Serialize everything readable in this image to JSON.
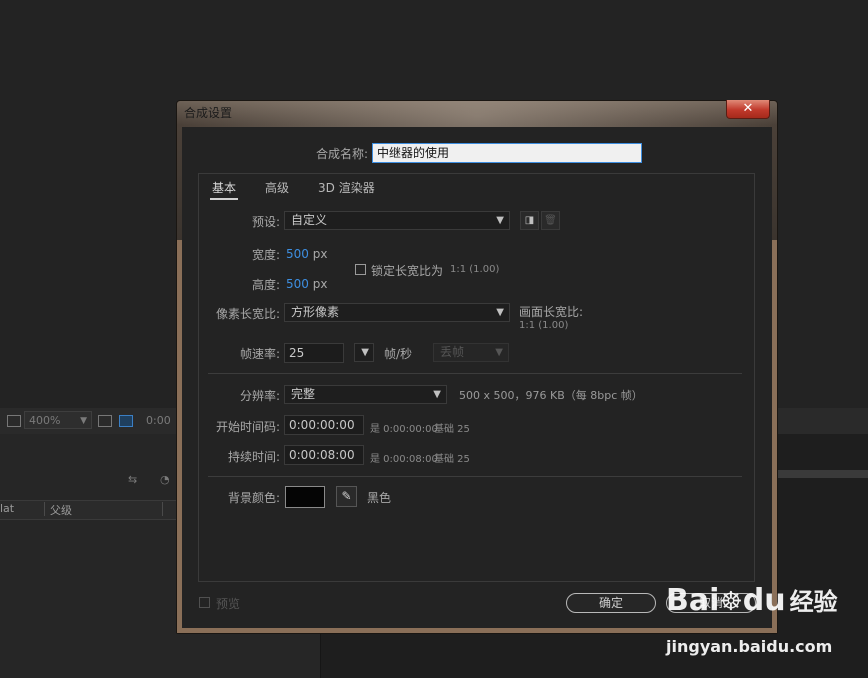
{
  "background": {
    "zoom": "400%",
    "timecode_partial": "0:00",
    "layer_col_1": "lat",
    "layer_col_2": "父级"
  },
  "dialog": {
    "title": "合成设置",
    "close": "✕",
    "name_label": "合成名称:",
    "name_value": "中继器的使用",
    "tabs": [
      "基本",
      "高级",
      "3D 渲染器"
    ],
    "preset_label": "预设:",
    "preset_value": "自定义",
    "width_label": "宽度:",
    "width_value": "500",
    "height_label": "高度:",
    "height_value": "500",
    "unit_px": "px",
    "lock_ratio_label": "锁定长宽比为",
    "lock_ratio_value": "1:1 (1.00)",
    "pixel_aspect_label": "像素长宽比:",
    "pixel_aspect_value": "方形像素",
    "frame_aspect_label": "画面长宽比:",
    "frame_aspect_value": "1:1 (1.00)",
    "frame_rate_label": "帧速率:",
    "frame_rate_value": "25",
    "frame_rate_unit": "帧/秒",
    "drop_frame_value": "丢帧",
    "resolution_label": "分辨率:",
    "resolution_value": "完整",
    "resolution_info": "500 x 500，976 KB（每 8bpc 帧）",
    "start_tc_label": "开始时间码:",
    "start_tc_value": "0:00:00:00",
    "start_tc_info": "是 0:00:00:00",
    "start_tc_base": "基础 25",
    "duration_label": "持续时间:",
    "duration_value": "0:00:08:00",
    "duration_info": "是 0:00:08:00",
    "duration_base": "基础 25",
    "bg_color_label": "背景颜色:",
    "bg_color_name": "黑色",
    "bg_color": "#050505",
    "preview_label": "预览",
    "ok_label": "确定",
    "cancel_label": "取消"
  },
  "watermark": {
    "brand": "Bai",
    "brand2": "du",
    "brand_cn": "经验",
    "url": "jingyan.baidu.com"
  }
}
